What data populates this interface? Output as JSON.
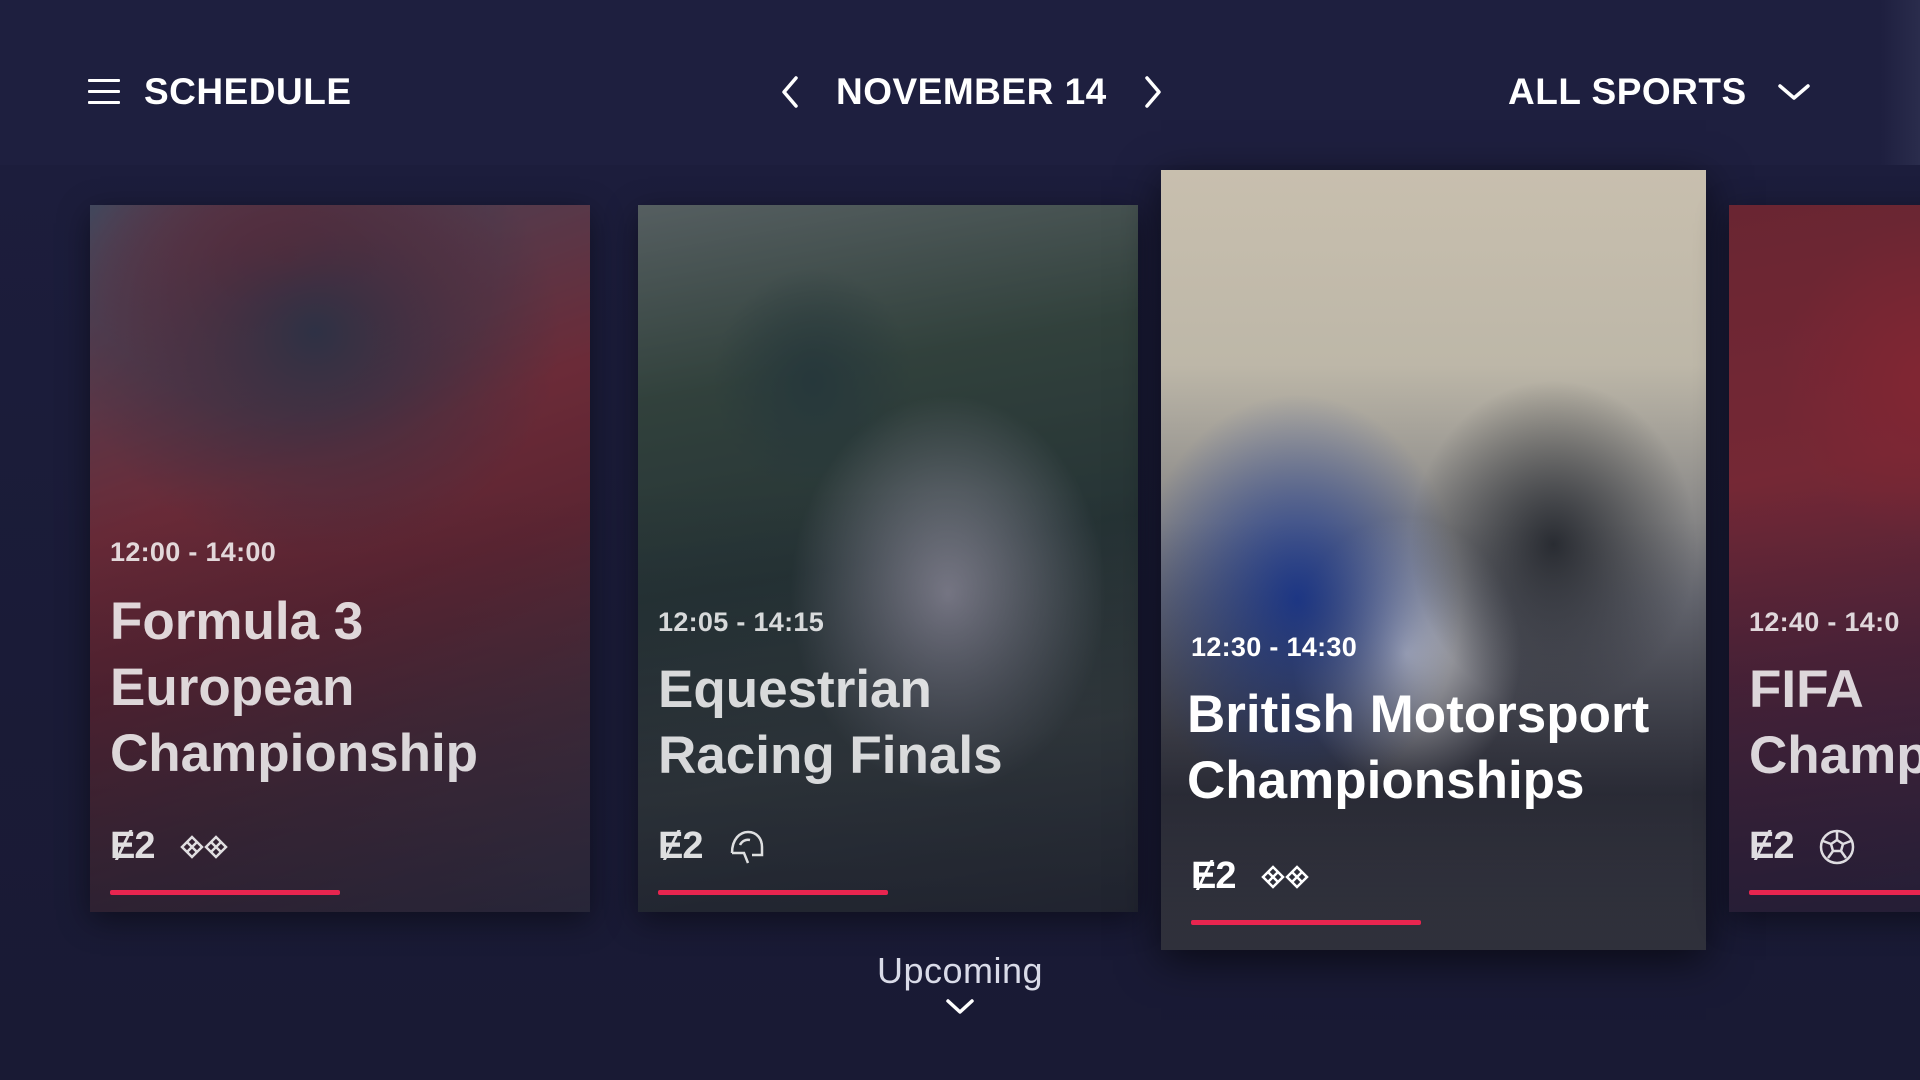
{
  "header": {
    "menu_label": "SCHEDULE",
    "date_label": "NOVEMBER 14",
    "filter_label": "ALL SPORTS"
  },
  "cards": [
    {
      "time": "12:00 -  14:00",
      "title": "Formula 3\nEuropean\nChampionship",
      "channel": "Ɇ2",
      "sport_icon": "checkered-flags-icon",
      "progress": 0.46
    },
    {
      "time": "12:05 -  14:15",
      "title": "Equestrian\nRacing Finals",
      "channel": "Ɇ2",
      "sport_icon": "riding-helmet-icon",
      "progress": 0.46
    },
    {
      "time": "12:30 -  14:30",
      "title": "British Motorsport\nChampionships",
      "channel": "Ɇ2",
      "sport_icon": "checkered-flags-icon",
      "progress": 0.46,
      "focused": true
    },
    {
      "time": "12:40 -  14:0",
      "title": "FIFA\nChamp",
      "channel": "Ɇ2",
      "sport_icon": "soccer-ball-icon",
      "progress": 0.6
    }
  ],
  "upcoming_label": "Upcoming",
  "colors": {
    "background": "#1c1d3a",
    "header": "#1e1f3f",
    "progress": "#e8254f"
  }
}
